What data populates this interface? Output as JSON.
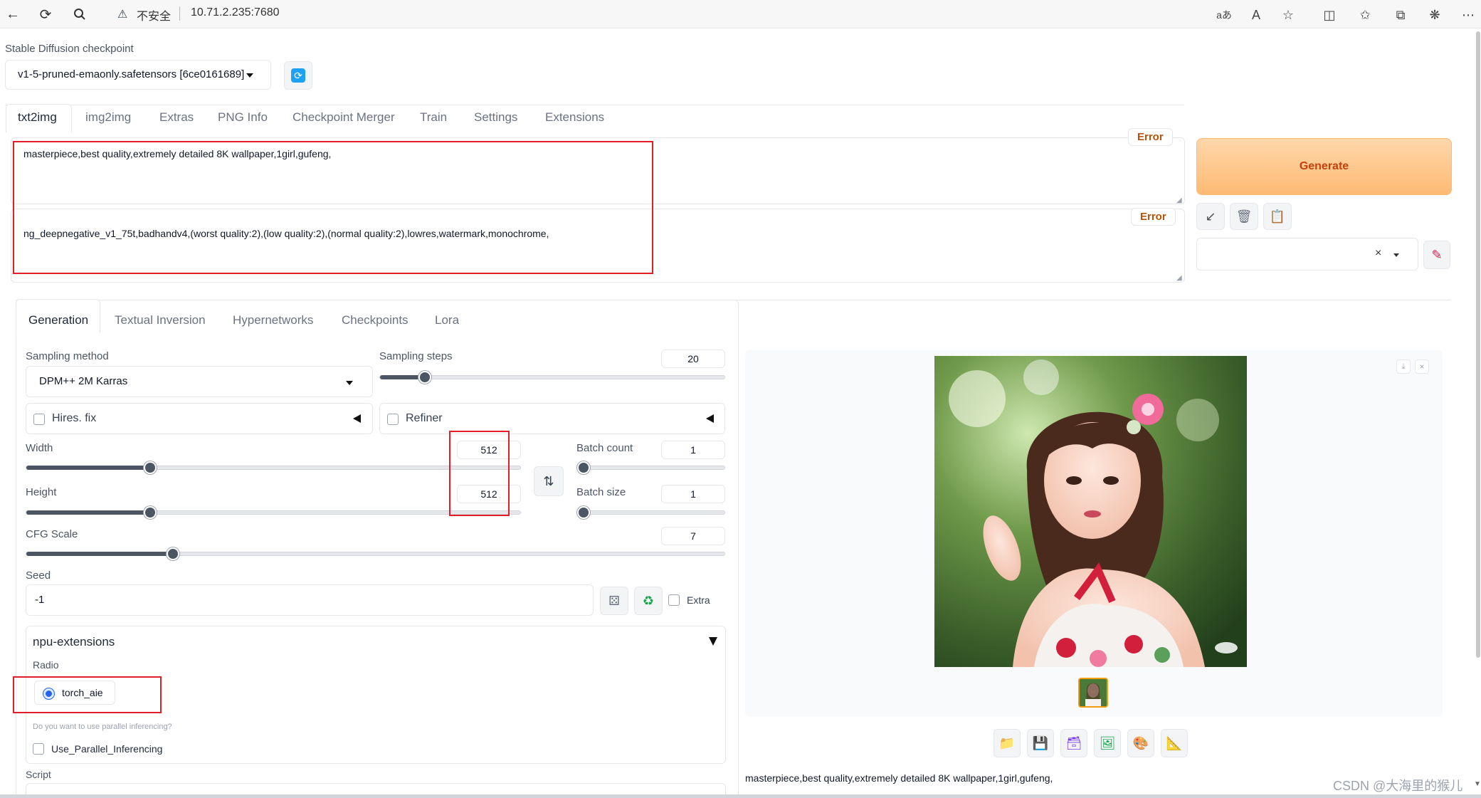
{
  "browser": {
    "security_label": "不安全",
    "address": "10.71.2.235:7680"
  },
  "checkpoint": {
    "label": "Stable Diffusion checkpoint",
    "value": "v1-5-pruned-emaonly.safetensors [6ce0161689]"
  },
  "main_tabs": [
    "txt2img",
    "img2img",
    "Extras",
    "PNG Info",
    "Checkpoint Merger",
    "Train",
    "Settings",
    "Extensions"
  ],
  "prompt": {
    "positive": "masterpiece,best quality,extremely detailed 8K wallpaper,1girl,gufeng,",
    "negative": "ng_deepnegative_v1_75t,badhandv4,(worst quality:2),(low quality:2),(normal quality:2),lowres,watermark,monochrome,",
    "error_label": "Error"
  },
  "generate_label": "Generate",
  "sub_tabs": [
    "Generation",
    "Textual Inversion",
    "Hypernetworks",
    "Checkpoints",
    "Lora"
  ],
  "sampling": {
    "method_label": "Sampling method",
    "method_value": "DPM++ 2M Karras",
    "steps_label": "Sampling steps",
    "steps_value": "20",
    "steps_fraction": 0.13
  },
  "hires_label": "Hires. fix",
  "refiner_label": "Refiner",
  "width": {
    "label": "Width",
    "value": "512",
    "fraction": 0.25
  },
  "height": {
    "label": "Height",
    "value": "512",
    "fraction": 0.25
  },
  "batch_count": {
    "label": "Batch count",
    "value": "1",
    "fraction": 0.0
  },
  "batch_size": {
    "label": "Batch size",
    "value": "1",
    "fraction": 0.0
  },
  "cfg": {
    "label": "CFG Scale",
    "value": "7",
    "fraction": 0.21
  },
  "seed": {
    "label": "Seed",
    "value": "-1",
    "extra_label": "Extra"
  },
  "npu": {
    "title": "npu-extensions",
    "radio_label": "Radio",
    "radio_option": "torch_aie",
    "question": "Do you want to use parallel inferencing?",
    "parallel_label": "Use_Parallel_Inferencing"
  },
  "script_label": "Script",
  "output_caption": "masterpiece,best quality,extremely detailed 8K wallpaper,1girl,gufeng,",
  "watermark": "CSDN @大海里的猴儿"
}
